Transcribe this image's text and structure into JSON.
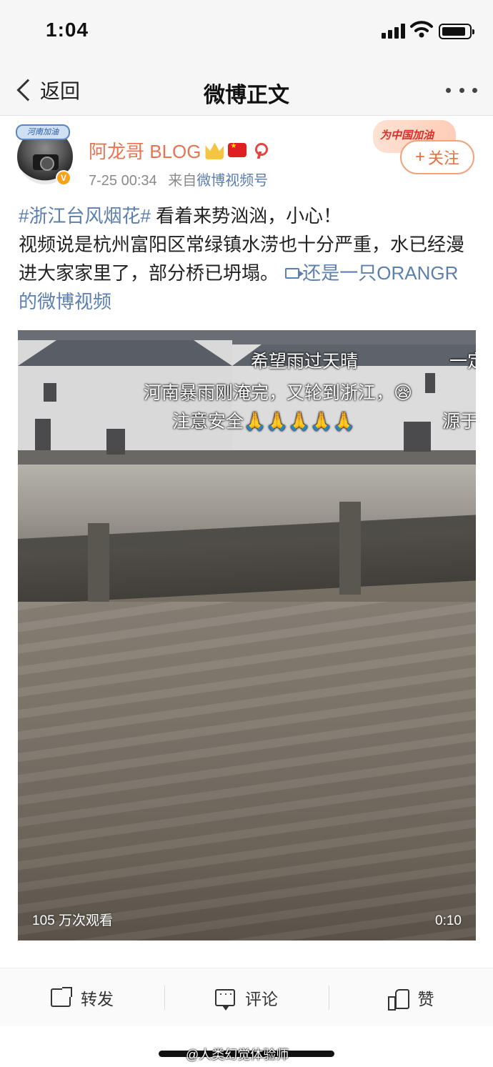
{
  "status_bar": {
    "time": "1:04"
  },
  "nav": {
    "back_label": "返回",
    "title": "微博正文"
  },
  "post": {
    "avatar_banner": "河南加油",
    "username": "阿龙哥 BLOG",
    "timestamp": "7-25 00:34",
    "source_prefix": "来自",
    "source": "微博视频号",
    "promo_badge": "为中国加油",
    "follow_label": "关注",
    "hashtag": "#浙江台风烟花#",
    "text_line1": " 看着来势汹汹，小心！",
    "text_body": "视频说是杭州富阳区常绿镇水涝也十分严重，水已经漫进大家家里了，部分桥已坍塌。",
    "video_link": "还是一只ORANGR的微博视频"
  },
  "video": {
    "caption_1": "希望雨过天晴",
    "caption_1b": "一定",
    "caption_2": "河南暴雨刚淹完，又轮到浙江，😪",
    "caption_3": "注意安全🙏🙏🙏🙏🙏",
    "caption_3b": "源于",
    "views": "105 万次观看",
    "duration": "0:10"
  },
  "actions": {
    "repost_label": "转发",
    "comment_label": "评论",
    "like_label": "赞"
  },
  "watermark": "@人类幻觉体验师",
  "colors": {
    "accent_orange": "#eb7350",
    "link_blue": "#5b7fb0"
  }
}
